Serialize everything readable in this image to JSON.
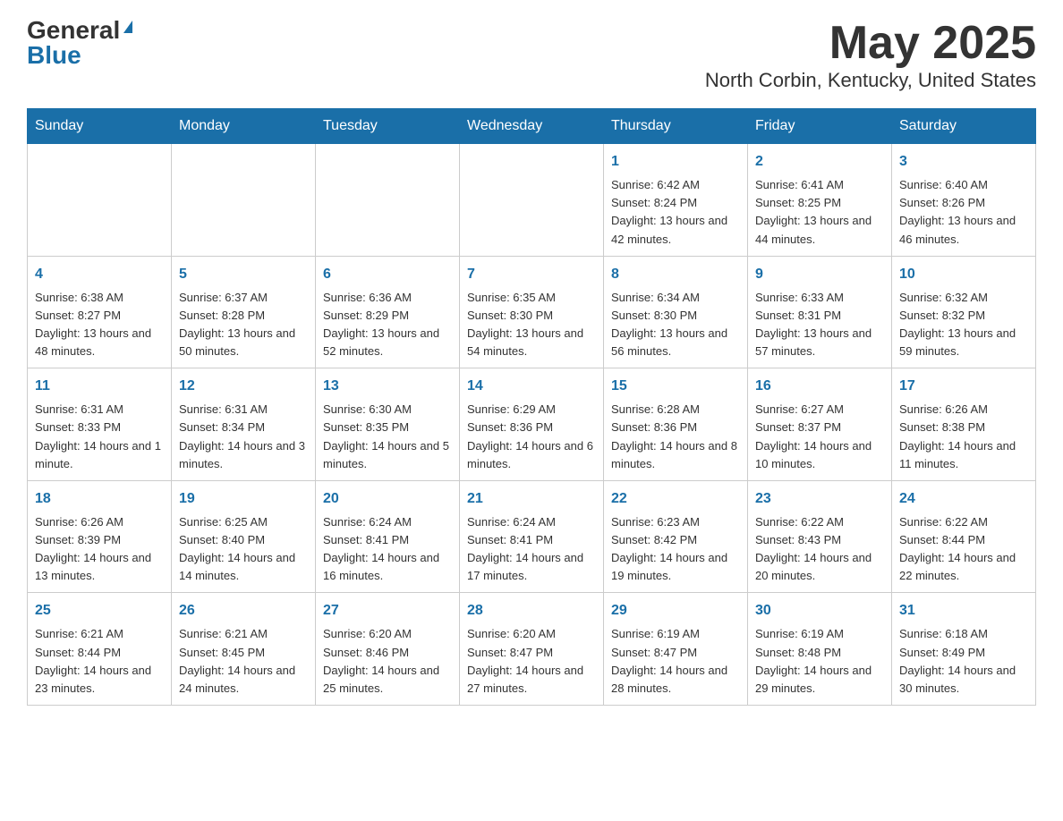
{
  "header": {
    "logo_general": "General",
    "logo_blue": "Blue",
    "title": "May 2025",
    "subtitle": "North Corbin, Kentucky, United States"
  },
  "days_of_week": [
    "Sunday",
    "Monday",
    "Tuesday",
    "Wednesday",
    "Thursday",
    "Friday",
    "Saturday"
  ],
  "weeks": [
    [
      {
        "day": "",
        "info": ""
      },
      {
        "day": "",
        "info": ""
      },
      {
        "day": "",
        "info": ""
      },
      {
        "day": "",
        "info": ""
      },
      {
        "day": "1",
        "info": "Sunrise: 6:42 AM\nSunset: 8:24 PM\nDaylight: 13 hours and 42 minutes."
      },
      {
        "day": "2",
        "info": "Sunrise: 6:41 AM\nSunset: 8:25 PM\nDaylight: 13 hours and 44 minutes."
      },
      {
        "day": "3",
        "info": "Sunrise: 6:40 AM\nSunset: 8:26 PM\nDaylight: 13 hours and 46 minutes."
      }
    ],
    [
      {
        "day": "4",
        "info": "Sunrise: 6:38 AM\nSunset: 8:27 PM\nDaylight: 13 hours and 48 minutes."
      },
      {
        "day": "5",
        "info": "Sunrise: 6:37 AM\nSunset: 8:28 PM\nDaylight: 13 hours and 50 minutes."
      },
      {
        "day": "6",
        "info": "Sunrise: 6:36 AM\nSunset: 8:29 PM\nDaylight: 13 hours and 52 minutes."
      },
      {
        "day": "7",
        "info": "Sunrise: 6:35 AM\nSunset: 8:30 PM\nDaylight: 13 hours and 54 minutes."
      },
      {
        "day": "8",
        "info": "Sunrise: 6:34 AM\nSunset: 8:30 PM\nDaylight: 13 hours and 56 minutes."
      },
      {
        "day": "9",
        "info": "Sunrise: 6:33 AM\nSunset: 8:31 PM\nDaylight: 13 hours and 57 minutes."
      },
      {
        "day": "10",
        "info": "Sunrise: 6:32 AM\nSunset: 8:32 PM\nDaylight: 13 hours and 59 minutes."
      }
    ],
    [
      {
        "day": "11",
        "info": "Sunrise: 6:31 AM\nSunset: 8:33 PM\nDaylight: 14 hours and 1 minute."
      },
      {
        "day": "12",
        "info": "Sunrise: 6:31 AM\nSunset: 8:34 PM\nDaylight: 14 hours and 3 minutes."
      },
      {
        "day": "13",
        "info": "Sunrise: 6:30 AM\nSunset: 8:35 PM\nDaylight: 14 hours and 5 minutes."
      },
      {
        "day": "14",
        "info": "Sunrise: 6:29 AM\nSunset: 8:36 PM\nDaylight: 14 hours and 6 minutes."
      },
      {
        "day": "15",
        "info": "Sunrise: 6:28 AM\nSunset: 8:36 PM\nDaylight: 14 hours and 8 minutes."
      },
      {
        "day": "16",
        "info": "Sunrise: 6:27 AM\nSunset: 8:37 PM\nDaylight: 14 hours and 10 minutes."
      },
      {
        "day": "17",
        "info": "Sunrise: 6:26 AM\nSunset: 8:38 PM\nDaylight: 14 hours and 11 minutes."
      }
    ],
    [
      {
        "day": "18",
        "info": "Sunrise: 6:26 AM\nSunset: 8:39 PM\nDaylight: 14 hours and 13 minutes."
      },
      {
        "day": "19",
        "info": "Sunrise: 6:25 AM\nSunset: 8:40 PM\nDaylight: 14 hours and 14 minutes."
      },
      {
        "day": "20",
        "info": "Sunrise: 6:24 AM\nSunset: 8:41 PM\nDaylight: 14 hours and 16 minutes."
      },
      {
        "day": "21",
        "info": "Sunrise: 6:24 AM\nSunset: 8:41 PM\nDaylight: 14 hours and 17 minutes."
      },
      {
        "day": "22",
        "info": "Sunrise: 6:23 AM\nSunset: 8:42 PM\nDaylight: 14 hours and 19 minutes."
      },
      {
        "day": "23",
        "info": "Sunrise: 6:22 AM\nSunset: 8:43 PM\nDaylight: 14 hours and 20 minutes."
      },
      {
        "day": "24",
        "info": "Sunrise: 6:22 AM\nSunset: 8:44 PM\nDaylight: 14 hours and 22 minutes."
      }
    ],
    [
      {
        "day": "25",
        "info": "Sunrise: 6:21 AM\nSunset: 8:44 PM\nDaylight: 14 hours and 23 minutes."
      },
      {
        "day": "26",
        "info": "Sunrise: 6:21 AM\nSunset: 8:45 PM\nDaylight: 14 hours and 24 minutes."
      },
      {
        "day": "27",
        "info": "Sunrise: 6:20 AM\nSunset: 8:46 PM\nDaylight: 14 hours and 25 minutes."
      },
      {
        "day": "28",
        "info": "Sunrise: 6:20 AM\nSunset: 8:47 PM\nDaylight: 14 hours and 27 minutes."
      },
      {
        "day": "29",
        "info": "Sunrise: 6:19 AM\nSunset: 8:47 PM\nDaylight: 14 hours and 28 minutes."
      },
      {
        "day": "30",
        "info": "Sunrise: 6:19 AM\nSunset: 8:48 PM\nDaylight: 14 hours and 29 minutes."
      },
      {
        "day": "31",
        "info": "Sunrise: 6:18 AM\nSunset: 8:49 PM\nDaylight: 14 hours and 30 minutes."
      }
    ]
  ]
}
